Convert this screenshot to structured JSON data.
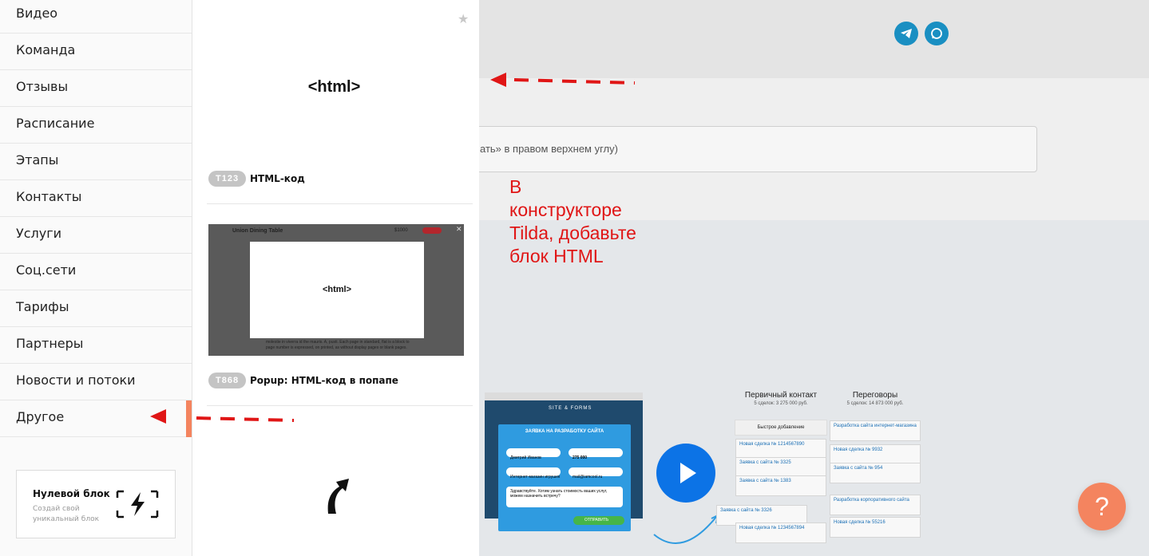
{
  "categories": [
    "Видео",
    "Команда",
    "Отзывы",
    "Расписание",
    "Этапы",
    "Контакты",
    "Услуги",
    "Соц.сети",
    "Тарифы",
    "Партнеры",
    "Новости и потоки",
    "Другое"
  ],
  "zero_block": {
    "title": "Нулевой блок",
    "subtitle": "Создай свой уникальный блок"
  },
  "blocks": [
    {
      "code": "T123",
      "name": "HTML-код",
      "preview_text": "<html>"
    },
    {
      "code": "T868",
      "name": "Popup: HTML-код в попапе",
      "preview_text": "<html>",
      "thumb": {
        "title": "Union Dining Table",
        "price": "$1000",
        "body": "molestie in viverra id the mauris. A, pusti. Each page in standard, flat is a block to page number is expressed, on printed, as without display pages or blank pages."
      }
    }
  ],
  "editor_bg": {
    "input_text": "ать» в правом верхнем углу)"
  },
  "annotation": {
    "text": "В\nконструкторе\nTilda, добавьте\nблок HTML",
    "color": "#e01616"
  },
  "promo": {
    "site_name": "SITE & FORMS",
    "form_title": "ЗАЯВКА НА РАЗРАБОТКУ САЙТА",
    "fields": [
      "Дмитрий Иванов",
      "275 000",
      "Интернет-магазин игрушек",
      "mail@iamcool.ru"
    ],
    "message": "Здравствуйте. Хотим узнать стоимость ваших услуг, можем назначить встречу?",
    "submit": "ОТПРАВИТЬ",
    "crm": {
      "col1": {
        "title": "Первичный контакт",
        "sub": "5 сделок: 3 275 000 руб.",
        "add": "Быстрое добавление",
        "cards": [
          "Новая сделка № 1214567890",
          "Заявка с сайта № 3325",
          "Заявка с сайта № 1383",
          "Заявка с сайта № 3326",
          "Новая сделка № 1234567894"
        ]
      },
      "col2": {
        "title": "Переговоры",
        "sub": "5 сделок: 14 873 000 руб.",
        "cards": [
          "Разработка сайта интернет-магазина",
          "Новая сделка № 9932",
          "Заявка с сайта № 954",
          "Разработка корпоративного сайта",
          "Новая сделка № 55216"
        ]
      }
    }
  },
  "help_label": "?",
  "colors": {
    "accent": "#f4845f",
    "telegram": "#1a8fc2",
    "annotation": "#e01616"
  }
}
